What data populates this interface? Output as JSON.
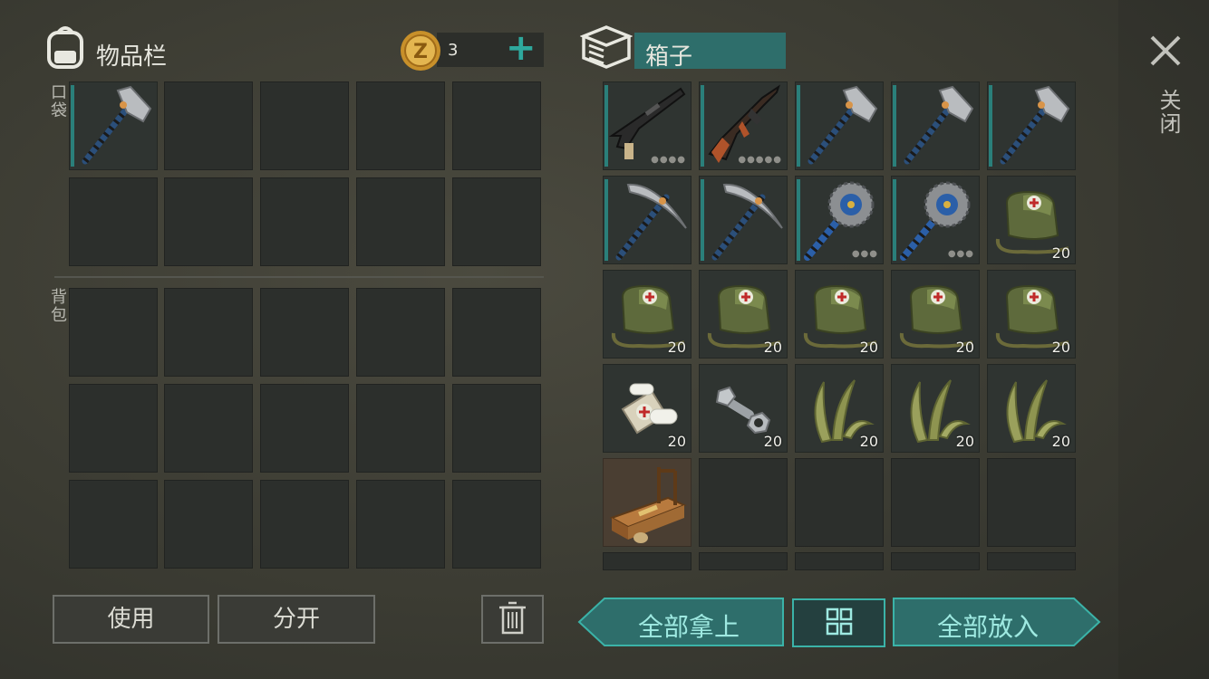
{
  "inventory": {
    "title": "物品栏",
    "coins": "3",
    "add_symbol": "+",
    "pocket_label": "口袋",
    "backpack_label": "背包"
  },
  "container": {
    "title": "箱子",
    "close_label": "关闭",
    "slots": [
      {
        "item": "shotgun-icon",
        "count": "",
        "dots": "●●●●"
      },
      {
        "item": "assault-rifle-icon",
        "count": "",
        "dots": "●●●●●"
      },
      {
        "item": "hatchet-icon",
        "count": "",
        "dots": ""
      },
      {
        "item": "hatchet-icon",
        "count": "",
        "dots": ""
      },
      {
        "item": "hatchet-icon",
        "count": "",
        "dots": ""
      },
      {
        "item": "pickaxe-icon",
        "count": "",
        "dots": ""
      },
      {
        "item": "pickaxe-icon",
        "count": "",
        "dots": ""
      },
      {
        "item": "saw-mace-icon",
        "count": "",
        "dots": "●●●"
      },
      {
        "item": "saw-mace-icon",
        "count": "",
        "dots": "●●●"
      },
      {
        "item": "medkit-bag-icon",
        "count": "20",
        "dots": ""
      },
      {
        "item": "medkit-bag-icon",
        "count": "20",
        "dots": ""
      },
      {
        "item": "medkit-bag-icon",
        "count": "20",
        "dots": ""
      },
      {
        "item": "medkit-bag-icon",
        "count": "20",
        "dots": ""
      },
      {
        "item": "medkit-bag-icon",
        "count": "20",
        "dots": ""
      },
      {
        "item": "medkit-bag-icon",
        "count": "20",
        "dots": ""
      },
      {
        "item": "bandage-icon",
        "count": "20",
        "dots": ""
      },
      {
        "item": "bolt-nut-icon",
        "count": "20",
        "dots": ""
      },
      {
        "item": "plant-fiber-icon",
        "count": "20",
        "dots": ""
      },
      {
        "item": "plant-fiber-icon",
        "count": "20",
        "dots": ""
      },
      {
        "item": "plant-fiber-icon",
        "count": "20",
        "dots": ""
      },
      {
        "item": "workbench-icon",
        "count": "",
        "dots": ""
      }
    ]
  },
  "actions": {
    "use": "使用",
    "split": "分开",
    "take_all": "全部拿上",
    "put_all": "全部放入"
  }
}
